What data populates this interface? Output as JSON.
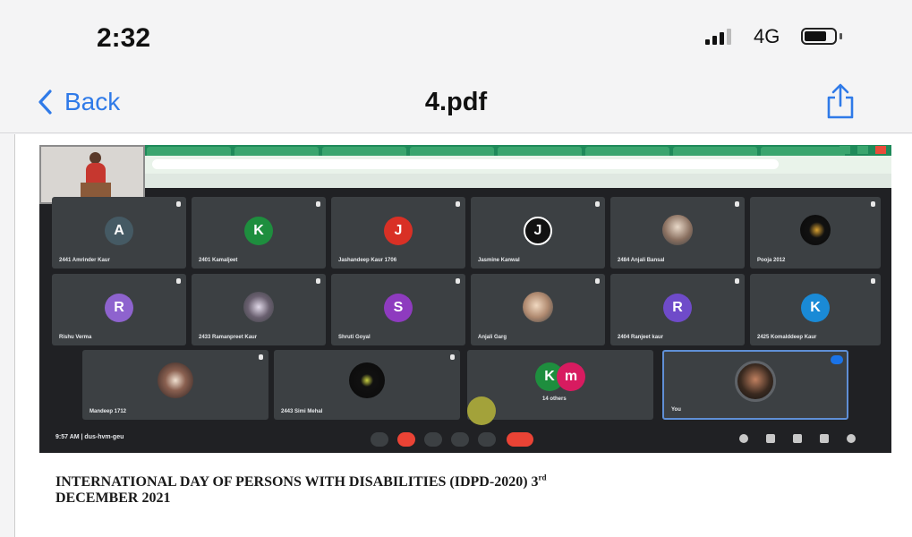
{
  "status_bar": {
    "time": "2:32",
    "network": "4G"
  },
  "nav": {
    "back_label": "Back",
    "title": "4.pdf",
    "accent_color": "#2f7ae8"
  },
  "meet": {
    "tiles_row1": [
      {
        "initial": "A",
        "color": "#455a64",
        "name": "2441 Amrinder Kaur"
      },
      {
        "initial": "K",
        "color": "#1e8e3e",
        "name": "2401 Kamaljeet"
      },
      {
        "initial": "J",
        "color": "#d93025",
        "name": "Jashandeep Kaur 1706"
      },
      {
        "initial": "J",
        "color": "#111111",
        "name": "Jasmine Kanwal"
      },
      {
        "initial": "",
        "color": "#7a6e66",
        "name": "2484 Anjali Bansal"
      },
      {
        "initial": "",
        "color": "#0d0d0d",
        "name": "Pooja 2012"
      }
    ],
    "tiles_row2": [
      {
        "initial": "R",
        "color": "#8e63ce",
        "name": "Rishu Verma"
      },
      {
        "initial": "",
        "color": "#5b5560",
        "name": "2433 Ramanpreet Kaur"
      },
      {
        "initial": "S",
        "color": "#8e3bbf",
        "name": "Shruti Goyal"
      },
      {
        "initial": "",
        "color": "#b39a80",
        "name": "Anjali Garg"
      },
      {
        "initial": "R",
        "color": "#6f4bc9",
        "name": "2404 Ranjeet kaur"
      },
      {
        "initial": "K",
        "color": "#1a8ad6",
        "name": "2425 Komalddeep Kaur"
      }
    ],
    "tiles_row3": [
      {
        "initial": "",
        "color": "#6a5040",
        "name": "Mandeep 1712"
      },
      {
        "initial": "",
        "color": "#101010",
        "name": "2443 Simi Mehal"
      },
      {
        "initial": "K",
        "color": "#1e8e3e",
        "name": "14 others"
      },
      {
        "initial": "",
        "color": "#2b2b2b",
        "name": "You"
      }
    ],
    "others_second_initial": "m",
    "meeting_time": "9:57 AM  |  dus-hvm-geu"
  },
  "document": {
    "caption_main": "INTERNATIONAL DAY OF PERSONS WITH DISABILITIES (IDPD-2020) 3",
    "caption_sup": "rd",
    "caption_end": "DECEMBER 2021"
  }
}
